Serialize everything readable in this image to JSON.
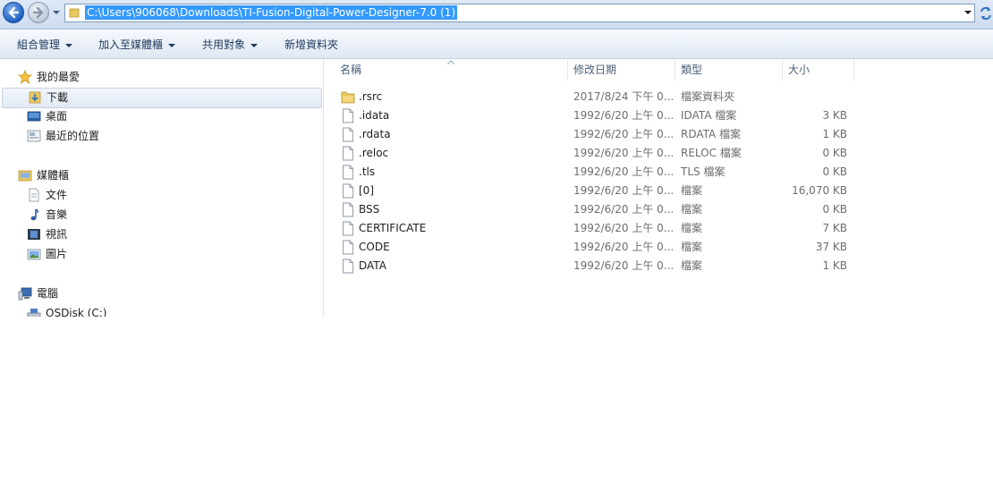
{
  "address": {
    "path": "C:\\Users\\906068\\Downloads\\TI-Fusion-Digital-Power-Designer-7.0 (1)"
  },
  "commands": {
    "organize": "組合管理",
    "add_to_library": "加入至媒體櫃",
    "share_with": "共用對象",
    "new_folder": "新增資料夾"
  },
  "nav": {
    "favorites": "我的最愛",
    "downloads": "下載",
    "desktop": "桌面",
    "recent": "最近的位置",
    "libraries": "媒體櫃",
    "documents": "文件",
    "music": "音樂",
    "videos": "視訊",
    "pictures": "圖片",
    "computer": "電腦",
    "osdisk": "OSDisk (C:)"
  },
  "columns": {
    "name": "名稱",
    "date": "修改日期",
    "type": "類型",
    "size": "大小"
  },
  "files": [
    {
      "name": ".rsrc",
      "date": "2017/8/24 下午 0...",
      "type": "檔案資料夾",
      "size": "",
      "icon": "folder-icon"
    },
    {
      "name": ".idata",
      "date": "1992/6/20 上午 0...",
      "type": "IDATA 檔案",
      "size": "3 KB",
      "icon": "file-icon"
    },
    {
      "name": ".rdata",
      "date": "1992/6/20 上午 0...",
      "type": "RDATA 檔案",
      "size": "1 KB",
      "icon": "file-icon"
    },
    {
      "name": ".reloc",
      "date": "1992/6/20 上午 0...",
      "type": "RELOC 檔案",
      "size": "0 KB",
      "icon": "file-icon"
    },
    {
      "name": ".tls",
      "date": "1992/6/20 上午 0...",
      "type": "TLS 檔案",
      "size": "0 KB",
      "icon": "file-icon"
    },
    {
      "name": "[0]",
      "date": "1992/6/20 上午 0...",
      "type": "檔案",
      "size": "16,070 KB",
      "icon": "file-icon"
    },
    {
      "name": "BSS",
      "date": "1992/6/20 上午 0...",
      "type": "檔案",
      "size": "0 KB",
      "icon": "file-icon"
    },
    {
      "name": "CERTIFICATE",
      "date": "1992/6/20 上午 0...",
      "type": "檔案",
      "size": "7 KB",
      "icon": "file-icon"
    },
    {
      "name": "CODE",
      "date": "1992/6/20 上午 0...",
      "type": "檔案",
      "size": "37 KB",
      "icon": "file-icon"
    },
    {
      "name": "DATA",
      "date": "1992/6/20 上午 0...",
      "type": "檔案",
      "size": "1 KB",
      "icon": "file-icon"
    }
  ],
  "colors": {
    "selection": "#3399ff",
    "chrome": "#dfe9f5"
  }
}
